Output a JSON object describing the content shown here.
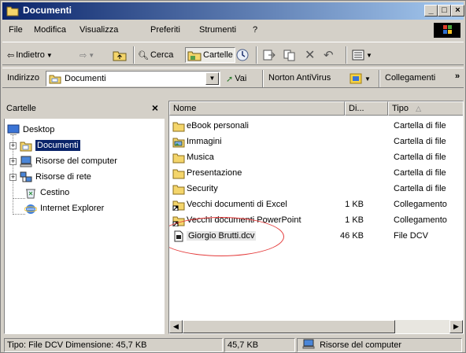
{
  "window": {
    "title": "Documenti"
  },
  "menu": [
    "File",
    "Modifica",
    "Visualizza",
    "Preferiti",
    "Strumenti",
    "?"
  ],
  "toolbar": {
    "back": "Indietro",
    "search": "Cerca",
    "folders": "Cartelle"
  },
  "address": {
    "label": "Indirizzo",
    "value": "Documenti",
    "go": "Vai",
    "norton": "Norton AntiVirus",
    "links": "Collegamenti"
  },
  "folders_pane": {
    "title": "Cartelle",
    "close": "×",
    "items": [
      {
        "label": "Desktop",
        "icon": "desktop-icon"
      },
      {
        "label": "Documenti",
        "icon": "my-documents-icon",
        "selected": true
      },
      {
        "label": "Risorse del computer",
        "icon": "my-computer-icon"
      },
      {
        "label": "Risorse di rete",
        "icon": "network-icon"
      },
      {
        "label": "Cestino",
        "icon": "recycle-bin-icon"
      },
      {
        "label": "Internet Explorer",
        "icon": "internet-explorer-icon"
      }
    ]
  },
  "file_list": {
    "columns": [
      "Nome",
      "Di...",
      "Tipo"
    ],
    "rows": [
      {
        "name": "eBook personali",
        "size": "",
        "type": "Cartella di file",
        "icon": "folder-icon"
      },
      {
        "name": "Immagini",
        "size": "",
        "type": "Cartella di file",
        "icon": "pictures-folder-icon"
      },
      {
        "name": "Musica",
        "size": "",
        "type": "Cartella di file",
        "icon": "folder-icon"
      },
      {
        "name": "Presentazione",
        "size": "",
        "type": "Cartella di file",
        "icon": "folder-icon"
      },
      {
        "name": "Security",
        "size": "",
        "type": "Cartella di file",
        "icon": "folder-icon"
      },
      {
        "name": "Vecchi documenti di Excel",
        "size": "1 KB",
        "type": "Collegamento",
        "icon": "shortcut-icon"
      },
      {
        "name": "Vecchi documenti PowerPoint",
        "size": "1 KB",
        "type": "Collegamento",
        "icon": "shortcut-icon"
      },
      {
        "name": "Giorgio Brutti.dcv",
        "size": "46 KB",
        "type": "File DCV",
        "icon": "dcv-file-icon",
        "highlighted": true
      }
    ]
  },
  "status": {
    "info": "Tipo: File DCV Dimensione: 45,7 KB",
    "size": "45,7 KB",
    "location": "Risorse del computer"
  },
  "colors": {
    "title_start": "#0a246a",
    "title_end": "#a6caf0",
    "selection": "#0a246a",
    "annotation": "#e43b3b"
  }
}
